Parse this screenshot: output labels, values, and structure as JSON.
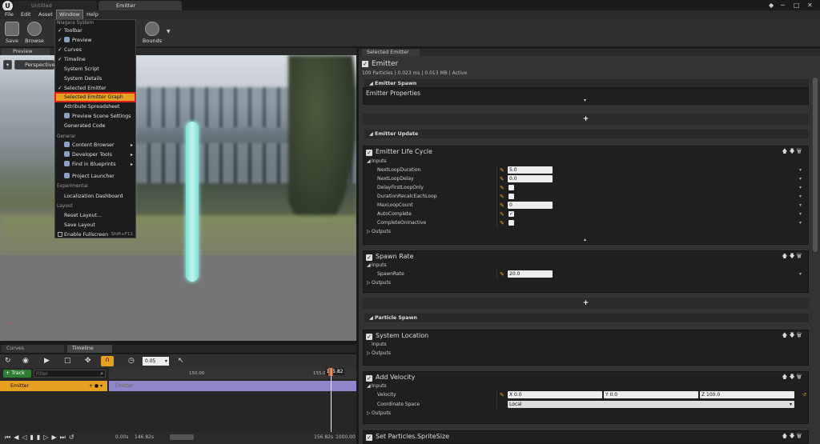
{
  "tabs": [
    "Untitled",
    "Emitter"
  ],
  "menubar": [
    "File",
    "Edit",
    "Asset",
    "Window",
    "Help"
  ],
  "toolbar": {
    "save": "Save",
    "browse": "Browse",
    "bounds": "Bounds"
  },
  "preview": {
    "tab": "Preview",
    "perspective": "Perspective"
  },
  "window_menu": {
    "section_niagara": "Niagara System",
    "items_niagara": [
      {
        "label": "Toolbar",
        "checked": true
      },
      {
        "label": "Preview",
        "checked": true
      },
      {
        "label": "Curves",
        "checked": true
      },
      {
        "label": "Timeline",
        "checked": true
      },
      {
        "label": "System Script",
        "checked": false
      },
      {
        "label": "System Details",
        "checked": false
      },
      {
        "label": "Selected Emitter",
        "checked": true
      },
      {
        "label": "Selected Emitter Graph",
        "checked": false
      },
      {
        "label": "Attribute Spreadsheet",
        "checked": false
      },
      {
        "label": "Preview Scene Settings",
        "checked": false
      },
      {
        "label": "Generated Code",
        "checked": false
      }
    ],
    "section_general": "General",
    "items_general": [
      "Content Browser",
      "Developer Tools",
      "Find in Blueprints",
      "Project Launcher"
    ],
    "section_experimental": "Experimental",
    "items_experimental": [
      "Localization Dashboard"
    ],
    "section_layout": "Layout",
    "items_layout": [
      "Reset Layout...",
      "Save Layout",
      "Enable Fullscreen"
    ],
    "fullscreen_shortcut": "Shift+F11"
  },
  "timeline": {
    "tabs": [
      "Curves",
      "Timeline"
    ],
    "track_btn": "+ Track",
    "filter_placeholder": "Filter",
    "snap_value": "0.05",
    "ruler": [
      "150.00",
      "155.00"
    ],
    "playhead": "155.82",
    "track_name": "Emitter",
    "bar_label": "Emitter",
    "footer": {
      "start": "0.00s",
      "view_start": "146.82s",
      "view_end": "156.82s",
      "end": "1000.00"
    }
  },
  "selected_emitter": {
    "tab": "Selected Emitter",
    "title": "Emitter",
    "stats": "100 Particles | 0.023 ms | 0.013 MB | Active",
    "emitter_spawn": "Emitter Spawn",
    "emitter_properties": "Emitter Properties",
    "emitter_update": "Emitter Update",
    "life_cycle": {
      "title": "Emitter Life Cycle",
      "inputs": "Inputs",
      "outputs": "Outputs",
      "params": [
        {
          "name": "NextLoopDuration",
          "value": "5.0"
        },
        {
          "name": "NextLoopDelay",
          "value": "0.0"
        },
        {
          "name": "DelayFirstLoopOnly",
          "value": ""
        },
        {
          "name": "DurationRecalcEachLoop",
          "value": ""
        },
        {
          "name": "MaxLoopCount",
          "value": "0"
        },
        {
          "name": "AutoComplete",
          "value": "✓"
        },
        {
          "name": "CompleteOnInactive",
          "value": ""
        }
      ]
    },
    "spawn_rate": {
      "title": "Spawn Rate",
      "inputs": "Inputs",
      "param": "SpawnRate",
      "value": "20.0",
      "outputs": "Outputs"
    },
    "particle_spawn": "Particle Spawn",
    "system_location": {
      "title": "System Location",
      "inputs": "Inputs",
      "outputs": "Outputs"
    },
    "add_velocity": {
      "title": "Add Velocity",
      "inputs": "Inputs",
      "velocity_label": "Velocity",
      "vx": "X 0.0",
      "vy": "Y 0.0",
      "vz": "Z 100.0",
      "coord_label": "Coordinate Space",
      "coord_value": "Local",
      "outputs": "Outputs"
    },
    "sprite_size": "Set Particles.SpriteSize"
  }
}
